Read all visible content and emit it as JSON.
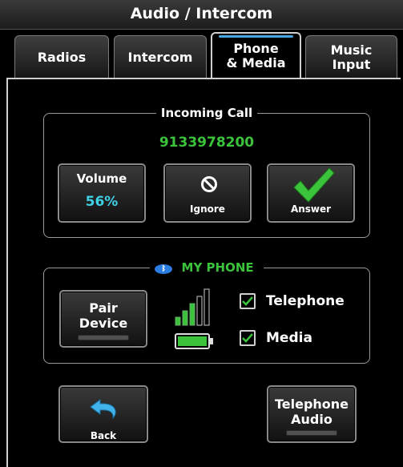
{
  "header": {
    "title": "Audio / Intercom"
  },
  "tabs": [
    {
      "label": "Radios",
      "active": false
    },
    {
      "label": "Intercom",
      "active": false
    },
    {
      "label_line1": "Phone",
      "label_line2": "& Media",
      "active": true
    },
    {
      "label_line1": "Music",
      "label_line2": "Input",
      "active": false
    }
  ],
  "incoming_call": {
    "group_label": "Incoming Call",
    "number": "9133978200",
    "volume_label": "Volume",
    "volume_value": "56%",
    "ignore_label": "Ignore",
    "answer_label": "Answer"
  },
  "my_phone": {
    "group_label": "MY PHONE",
    "pair_line1": "Pair",
    "pair_line2": "Device",
    "signal_bars_lit": 3,
    "signal_bars_total": 5,
    "telephone_label": "Telephone",
    "telephone_checked": true,
    "media_label": "Media",
    "media_checked": true
  },
  "footer": {
    "back_label": "Back",
    "tel_audio_line1": "Telephone",
    "tel_audio_line2": "Audio"
  },
  "colors": {
    "accent_green": "#3bc43b",
    "accent_cyan": "#3fd1e6",
    "tab_highlight": "#4aa6e0",
    "bluetooth_blue": "#2a7de1"
  }
}
